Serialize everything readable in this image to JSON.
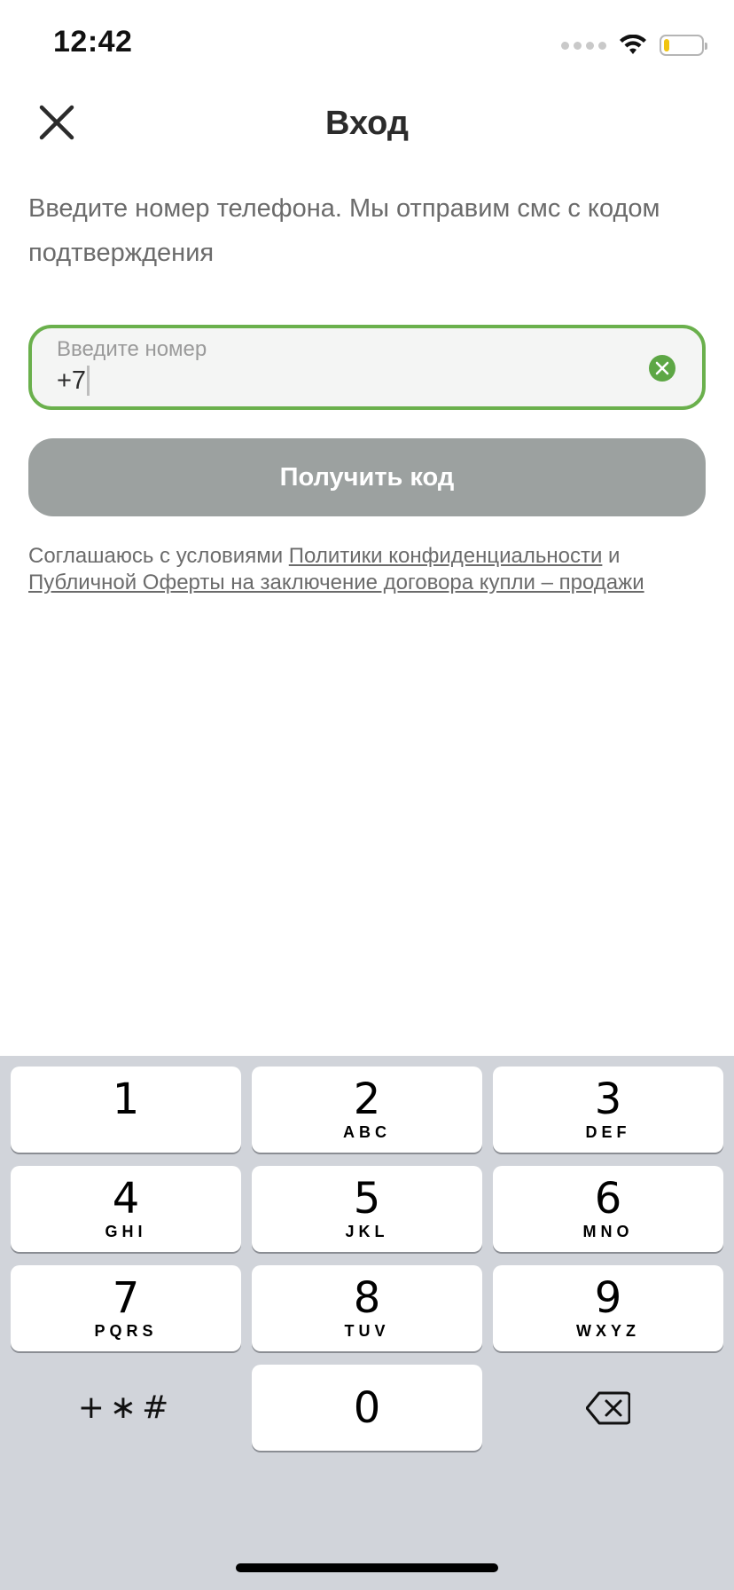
{
  "status_bar": {
    "time": "12:42",
    "battery_level": 0.15,
    "battery_color": "#f1c40f"
  },
  "header": {
    "title": "Вход",
    "close_icon": "close-icon"
  },
  "intro": {
    "text": "Введите номер телефона. Мы отправим смс с кодом подтверждения"
  },
  "phone_field": {
    "label": "Введите номер",
    "value": "+7",
    "border_color": "#6ab04c",
    "clear_icon": "clear-icon"
  },
  "get_code_button": {
    "label": "Получить код"
  },
  "consent": {
    "prefix": "Соглашаюсь с условиями ",
    "privacy_link": "Политики конфиденциальности",
    "conjunction": " и ",
    "offer_link": "Публичной Оферты на заключение договора купли – продажи"
  },
  "keyboard": {
    "keys": [
      {
        "digit": "1",
        "letters": ""
      },
      {
        "digit": "2",
        "letters": "ABC"
      },
      {
        "digit": "3",
        "letters": "DEF"
      },
      {
        "digit": "4",
        "letters": "GHI"
      },
      {
        "digit": "5",
        "letters": "JKL"
      },
      {
        "digit": "6",
        "letters": "MNO"
      },
      {
        "digit": "7",
        "letters": "PQRS"
      },
      {
        "digit": "8",
        "letters": "TUV"
      },
      {
        "digit": "9",
        "letters": "WXYZ"
      },
      {
        "digit": "0",
        "letters": ""
      }
    ],
    "symbols": "+∗#",
    "backspace_icon": "backspace-icon"
  }
}
